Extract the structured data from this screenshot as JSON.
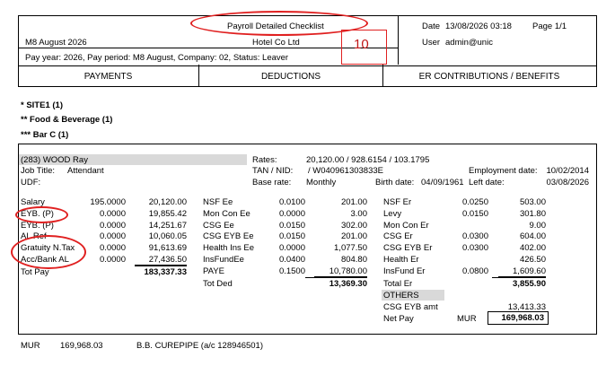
{
  "header": {
    "title": "Payroll Detailed Checklist",
    "date_label": "Date",
    "date_value": "13/08/2026 03:18",
    "page_label": "Page 1/1",
    "period": "M8 August 2026",
    "company": "Hotel Co Ltd",
    "user_label": "User",
    "user_value": "admin@unic",
    "annotation_number": "10",
    "filter": "Pay year: 2026, Pay period: M8 August, Company: 02, Status: Leaver"
  },
  "columns": {
    "payments": "PAYMENTS",
    "deductions": "DEDUCTIONS",
    "er": "ER CONTRIBUTIONS / BENEFITS"
  },
  "groups": [
    "* SITE1 (1)",
    "** Food & Beverage (1)",
    "*** Bar C (1)"
  ],
  "employee": {
    "name": "(283) WOOD Ray",
    "job_title_label": "Job Title:",
    "job_title": "Attendant",
    "udf_label": "UDF:",
    "rates_label": "Rates:",
    "rates_value": "20,120.00 / 928.6154 / 103.1795",
    "tan_label": "TAN / NID:",
    "tan_value": "/ W040961303833E",
    "base_rate_label": "Base rate:",
    "base_rate_value": "Monthly",
    "birth_label": "Birth date:",
    "birth_value": "04/09/1961",
    "left_label": "Left date:",
    "left_value": "03/08/2026",
    "employment_label": "Employment date:",
    "employment_value": "10/02/2014"
  },
  "payments": [
    {
      "label": "Salary",
      "rate": "195.0000",
      "amount": "20,120.00"
    },
    {
      "label": "EYB. (P)",
      "rate": "0.0000",
      "amount": "19,855.42"
    },
    {
      "label": "EYB. (P)",
      "rate": "0.0000",
      "amount": "14,251.67"
    },
    {
      "label": "AL Ref",
      "rate": "0.0000",
      "amount": "10,060.05"
    },
    {
      "label": "Gratuity N.Tax",
      "rate": "0.0000",
      "amount": "91,613.69"
    },
    {
      "label": "Acc/Bank AL",
      "rate": "0.0000",
      "amount": "27,436.50"
    }
  ],
  "tot_pay": {
    "label": "Tot Pay",
    "amount": "183,337.33"
  },
  "deductions": [
    {
      "label": "NSF Ee",
      "rate": "0.0100",
      "amount": "201.00"
    },
    {
      "label": "Mon Con Ee",
      "rate": "0.0000",
      "amount": "3.00"
    },
    {
      "label": "CSG Ee",
      "rate": "0.0150",
      "amount": "302.00"
    },
    {
      "label": "CSG EYB Ee",
      "rate": "0.0150",
      "amount": "201.00"
    },
    {
      "label": "Health Ins Ee",
      "rate": "0.0000",
      "amount": "1,077.50"
    },
    {
      "label": "InsFundEe",
      "rate": "0.0400",
      "amount": "804.80"
    },
    {
      "label": "PAYE",
      "rate": "0.1500",
      "amount": "10,780.00"
    }
  ],
  "tot_ded": {
    "label": "Tot Ded",
    "amount": "13,369.30"
  },
  "er": [
    {
      "label": "NSF Er",
      "rate": "0.0250",
      "amount": "503.00"
    },
    {
      "label": "Levy",
      "rate": "0.0150",
      "amount": "301.80"
    },
    {
      "label": "Mon Con Er",
      "rate": "",
      "amount": "9.00"
    },
    {
      "label": "CSG Er",
      "rate": "0.0300",
      "amount": "604.00"
    },
    {
      "label": "CSG EYB Er",
      "rate": "0.0300",
      "amount": "402.00"
    },
    {
      "label": "Health Er",
      "rate": "",
      "amount": "426.50"
    },
    {
      "label": "InsFund Er",
      "rate": "0.0800",
      "amount": "1,609.60"
    }
  ],
  "total_er": {
    "label": "Total Er",
    "amount": "3,855.90"
  },
  "others": {
    "label": "OTHERS",
    "csg_label": "CSG EYB amt",
    "csg_amount": "13,413.33",
    "net_label": "Net Pay",
    "net_currency": "MUR",
    "net_amount": "169,968.03"
  },
  "footer": {
    "currency": "MUR",
    "amount": "169,968.03",
    "bank": "B.B. CUREPIPE (a/c 128946501)"
  }
}
